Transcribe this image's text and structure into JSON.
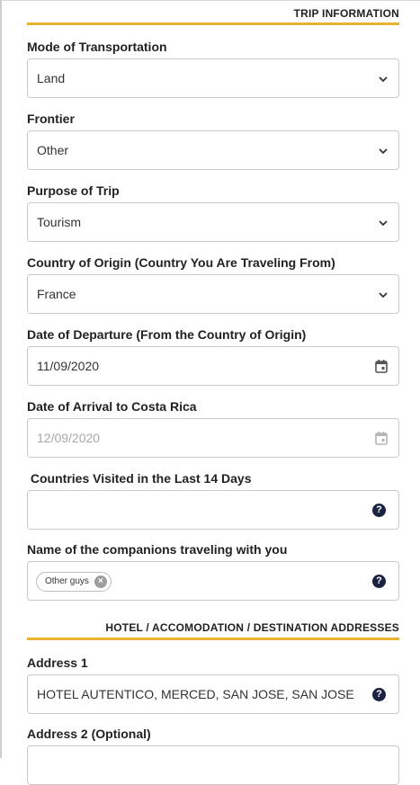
{
  "trip_section": {
    "title": "TRIP INFORMATION"
  },
  "fields": {
    "mode": {
      "label": "Mode of Transportation",
      "value": "Land"
    },
    "frontier": {
      "label": "Frontier",
      "value": "Other"
    },
    "purpose": {
      "label": "Purpose of Trip",
      "value": "Tourism"
    },
    "origin": {
      "label": "Country of Origin (Country You Are Traveling From)",
      "value": "France"
    },
    "departure": {
      "label": "Date of Departure (From the Country of Origin)",
      "value": "11/09/2020"
    },
    "arrival": {
      "label": "Date of Arrival to Costa Rica",
      "value": "12/09/2020"
    },
    "visited": {
      "label": " Countries Visited in the Last 14 Days",
      "value": ""
    },
    "companions": {
      "label": "Name of the companions traveling with you",
      "chips": [
        "Other guys"
      ]
    }
  },
  "address_section": {
    "title": "HOTEL / ACCOMODATION / DESTINATION ADDRESSES"
  },
  "address": {
    "address1": {
      "label": "Address 1",
      "value": "HOTEL AUTENTICO, MERCED, SAN JOSE, SAN JOSE"
    },
    "address2": {
      "label": "Address 2 (Optional)",
      "value": ""
    }
  },
  "icons": {
    "dropdown": "chevron-down-icon",
    "date": "calendar-icon",
    "help": "help-icon",
    "chip_remove": "close-circle-icon"
  },
  "help_glyph": "?",
  "chip_remove_glyph": "×",
  "colors": {
    "accent": "#e8b130",
    "help_icon": "#1c2340",
    "border": "#c9c9c9",
    "disabled_text": "#a8a8a8"
  }
}
